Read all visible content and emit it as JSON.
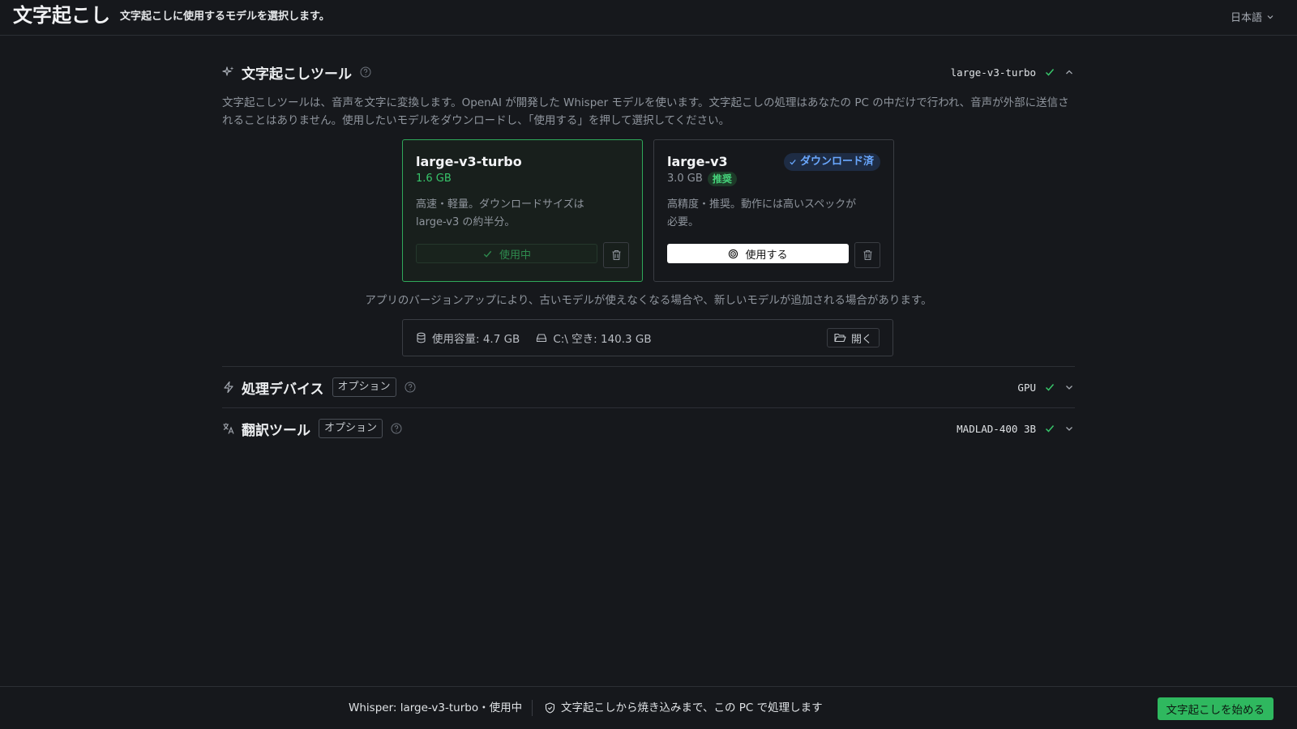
{
  "header": {
    "title": "文字起こし",
    "subtitle": "文字起こしに使用するモデルを選択します。",
    "language": "日本語"
  },
  "transcription_tool": {
    "title": "文字起こしツール",
    "current_value": "large-v3-turbo",
    "description": "文字起こしツールは、音声を文字に変換します。OpenAI が開発した Whisper モデルを使います。文字起こしの処理はあなたの PC の中だけで行われ、音声が外部に送信されることはありません。使用したいモデルをダウンロードし、「使用する」を押して選択してください。",
    "models": [
      {
        "name": "large-v3-turbo",
        "size": "1.6 GB",
        "description": "高速・軽量。ダウンロードサイズは large-v3 の約半分。",
        "button_label": "使用中"
      },
      {
        "name": "large-v3",
        "size": "3.0 GB",
        "badge_recommended": "推奨",
        "badge_downloaded": "ダウンロード済",
        "description": "高精度・推奨。動作には高いスペックが必要。",
        "button_label": "使用する"
      }
    ],
    "version_note": "アプリのバージョンアップにより、古いモデルが使えなくなる場合や、新しいモデルが追加される場合があります。",
    "storage": {
      "used": "使用容量: 4.7 GB",
      "free": "C:\\ 空き: 140.3 GB",
      "open_label": "開く"
    }
  },
  "processing_device": {
    "title": "処理デバイス",
    "option_label": "オプション",
    "current_value": "GPU"
  },
  "translation_tool": {
    "title": "翻訳ツール",
    "option_label": "オプション",
    "current_value": "MADLAD-400 3B"
  },
  "footer": {
    "status": "Whisper: large-v3-turbo・使用中",
    "privacy": "文字起こしから焼き込みまで、この PC で処理します",
    "start_label": "文字起こしを始める"
  },
  "colors": {
    "background": "#16181c",
    "accent_green": "#2fb85f",
    "accent_blue": "#6aa8ff"
  }
}
